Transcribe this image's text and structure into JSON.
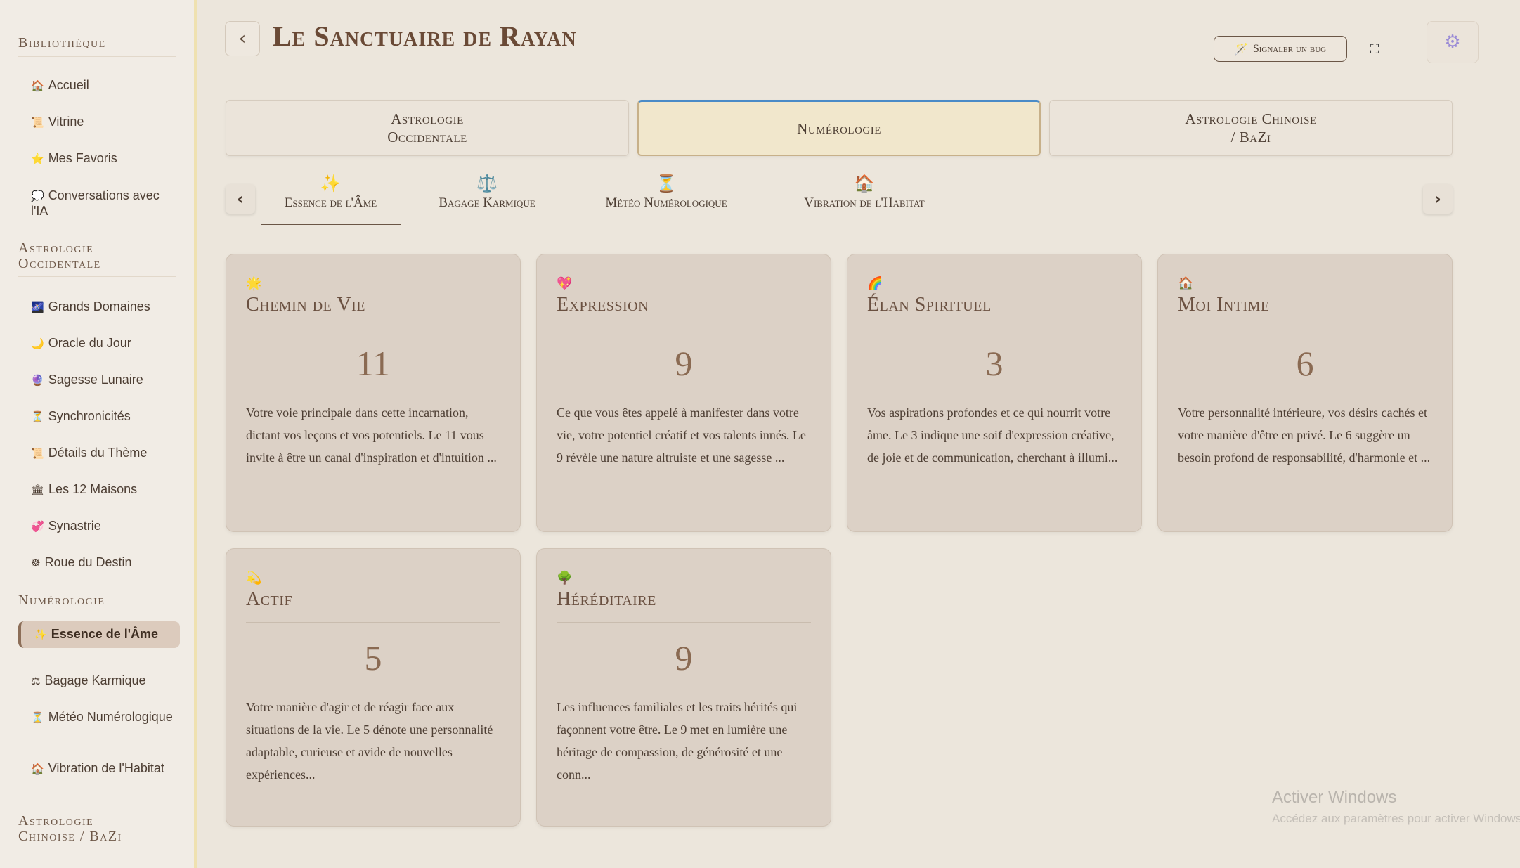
{
  "sidebar": {
    "sections": [
      {
        "title": "Bibliothèque",
        "items": [
          {
            "icon": "🏠",
            "label": "Accueil"
          },
          {
            "icon": "📜",
            "label": "Vitrine"
          },
          {
            "icon": "⭐",
            "label": "Mes Favoris"
          },
          {
            "icon": "💭",
            "label": "Conversations avec l'IA"
          }
        ]
      },
      {
        "title": "Astrologie Occidentale",
        "items": [
          {
            "icon": "🌌",
            "label": "Grands Domaines"
          },
          {
            "icon": "🌙",
            "label": "Oracle du Jour"
          },
          {
            "icon": "🔮",
            "label": "Sagesse Lunaire"
          },
          {
            "icon": "⏳",
            "label": "Synchronicités"
          },
          {
            "icon": "📜",
            "label": "Détails du Thème"
          },
          {
            "icon": "🏛",
            "label": "Les 12 Maisons"
          },
          {
            "icon": "💞",
            "label": "Synastrie"
          },
          {
            "icon": "☸",
            "label": "Roue du Destin"
          }
        ]
      },
      {
        "title": "Numérologie",
        "items": [
          {
            "icon": "✨",
            "label": "Essence de l'Âme",
            "active": true
          },
          {
            "icon": "⚖",
            "label": "Bagage Karmique"
          },
          {
            "icon": "⏳",
            "label": "Météo Numérologique"
          },
          {
            "icon": "🏠",
            "label": "Vibration de l'Habitat"
          }
        ]
      },
      {
        "title": "Astrologie Chinoise / BaZi",
        "items": []
      }
    ]
  },
  "header": {
    "title": "Le Sanctuaire de Rayan",
    "back_icon": "‹",
    "bug_button": {
      "icon": "🪄",
      "label": "Signaler un bug"
    },
    "fullscreen_icon": "⛶",
    "settings_icon": "⚙"
  },
  "main_tabs": [
    {
      "label": "Astrologie\nOccidentale",
      "active": false
    },
    {
      "label": "Numérologie",
      "active": true
    },
    {
      "label": "Astrologie Chinoise\n/ BaZi",
      "active": false
    }
  ],
  "sub_tabs": [
    {
      "icon": "✨",
      "label": "Essence de l'Âme",
      "active": true
    },
    {
      "icon": "⚖️",
      "label": "Bagage Karmique",
      "active": false
    },
    {
      "icon": "⏳",
      "label": "Météo Numérologique",
      "active": false
    },
    {
      "icon": "🏠",
      "label": "Vibration de l'Habitat",
      "active": false
    }
  ],
  "sub_nav": {
    "prev": "‹",
    "next": "›"
  },
  "cards": [
    {
      "icon": "🌟",
      "title": "Chemin de Vie",
      "number": "11",
      "desc": "Votre voie principale dans cette incarnation, dictant vos leçons et vos potentiels. Le 11 vous invite à être un canal d'inspiration et d'intuition ..."
    },
    {
      "icon": "💖",
      "title": "Expression",
      "number": "9",
      "desc": "Ce que vous êtes appelé à manifester dans votre vie, votre potentiel créatif et vos talents innés. Le 9 révèle une nature altruiste et une sagesse ..."
    },
    {
      "icon": "🌈",
      "title": "Élan Spirituel",
      "number": "3",
      "desc": "Vos aspirations profondes et ce qui nourrit votre âme. Le 3 indique une soif d'expression créative, de joie et de communication, cherchant à illumi..."
    },
    {
      "icon": "🏠",
      "title": "Moi Intime",
      "number": "6",
      "desc": "Votre personnalité intérieure, vos désirs cachés et votre manière d'être en privé. Le 6 suggère un besoin profond de responsabilité, d'harmonie et ..."
    },
    {
      "icon": "💫",
      "title": "Actif",
      "number": "5",
      "desc": "Votre manière d'agir et de réagir face aux situations de la vie. Le 5 dénote une personnalité adaptable, curieuse et avide de nouvelles expériences..."
    },
    {
      "icon": "🌳",
      "title": "Héréditaire",
      "number": "9",
      "desc": "Les influences familiales et les traits hérités qui façonnent votre être. Le 9 met en lumière une héritage de compassion, de générosité et une conn..."
    }
  ],
  "watermark": {
    "line1": "Activer Windows",
    "line2": "Accédez aux paramètres pour activer Windows."
  }
}
